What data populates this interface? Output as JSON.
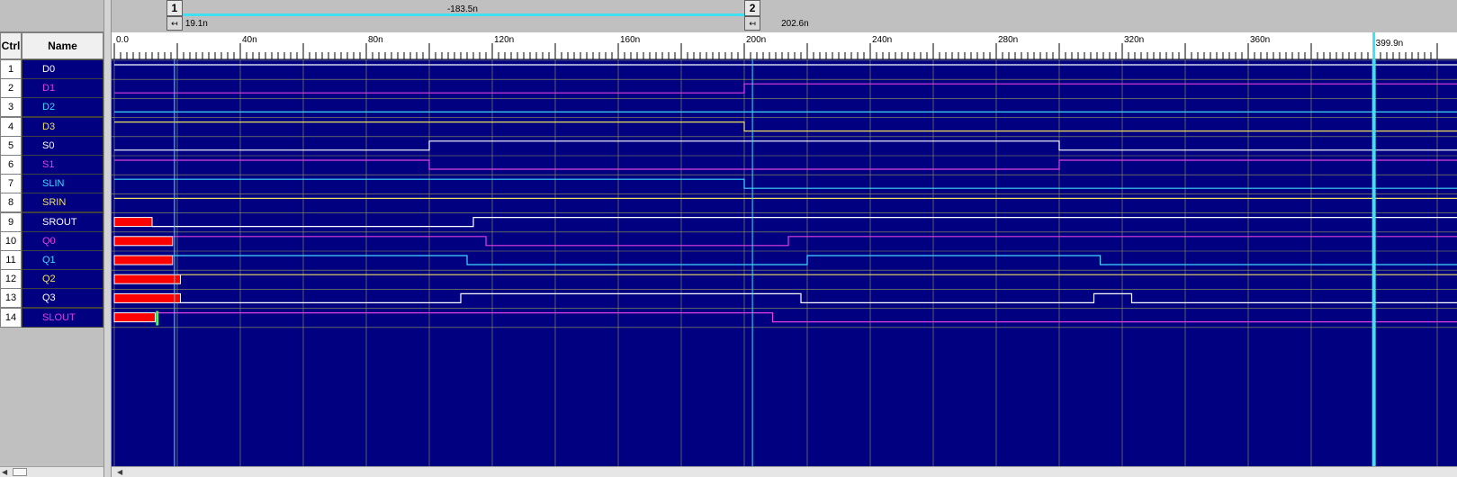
{
  "columns": {
    "ctrl": "Ctrl",
    "name": "Name"
  },
  "signals": [
    {
      "index": "1",
      "name": "D0",
      "color": "#ffffff"
    },
    {
      "index": "2",
      "name": "D1",
      "color": "#e040e0"
    },
    {
      "index": "3",
      "name": "D2",
      "color": "#40d8ff"
    },
    {
      "index": "4",
      "name": "D3",
      "color": "#f0e060"
    },
    {
      "index": "5",
      "name": "S0",
      "color": "#ffffff"
    },
    {
      "index": "6",
      "name": "S1",
      "color": "#e040e0"
    },
    {
      "index": "7",
      "name": "SLIN",
      "color": "#40d8ff"
    },
    {
      "index": "8",
      "name": "SRIN",
      "color": "#f0e060"
    },
    {
      "index": "9",
      "name": "SROUT",
      "color": "#ffffff"
    },
    {
      "index": "10",
      "name": "Q0",
      "color": "#e040e0"
    },
    {
      "index": "11",
      "name": "Q1",
      "color": "#40d8ff"
    },
    {
      "index": "12",
      "name": "Q2",
      "color": "#f0e060"
    },
    {
      "index": "13",
      "name": "Q3",
      "color": "#ffffff"
    },
    {
      "index": "14",
      "name": "SLOUT",
      "color": "#e040e0"
    }
  ],
  "cursors": {
    "cursor1": {
      "number": "1",
      "time_label": "19.1n",
      "time_ns": 19.1
    },
    "cursor2": {
      "number": "2",
      "time_label": "202.6n",
      "time_ns": 202.6
    },
    "delta_label": "-183.5n",
    "end_label": "399.9n",
    "end_ns": 399.9,
    "handle_glyph": "↤"
  },
  "ruler": {
    "labels": [
      "0.0",
      "40n",
      "80n",
      "120n",
      "160n",
      "200n",
      "240n",
      "280n",
      "320n",
      "360n"
    ],
    "label_values_ns": [
      0,
      40,
      80,
      120,
      160,
      200,
      240,
      280,
      320,
      360
    ]
  },
  "colors": {
    "background": "#000080",
    "grid": "#9a9a5a",
    "cursor": "#40e0f0",
    "unknown": "#ff0000",
    "glitch": "#40ff40"
  },
  "waveforms": {
    "D0": {
      "init": 1,
      "edges": []
    },
    "D1": {
      "init": 0,
      "edges": [
        200
      ]
    },
    "D2": {
      "init": 0,
      "edges": []
    },
    "D3": {
      "init": 1,
      "edges": [
        200
      ]
    },
    "S0": {
      "init": 0,
      "edges": [
        100,
        300
      ]
    },
    "S1": {
      "init": 1,
      "edges": [
        100,
        300
      ]
    },
    "SLIN": {
      "init": 1,
      "edges": [
        200
      ]
    },
    "SRIN": {
      "init": 1,
      "edges": []
    },
    "SROUT": {
      "unknown_until": 12,
      "init": 0,
      "edges": [
        114
      ]
    },
    "Q0": {
      "unknown_until": 18.5,
      "init": 1,
      "edges": [
        118,
        214
      ]
    },
    "Q1": {
      "unknown_until": 18.5,
      "init": 1,
      "edges": [
        112,
        220,
        313
      ]
    },
    "Q2": {
      "unknown_until": 21,
      "init": 1,
      "edges": []
    },
    "Q3": {
      "unknown_until": 21,
      "init": 0,
      "edges": [
        110,
        218,
        311,
        323
      ]
    },
    "SLOUT": {
      "unknown_until": 13,
      "glitch_at": 13.5,
      "init": 1,
      "edges": [
        209
      ]
    }
  }
}
